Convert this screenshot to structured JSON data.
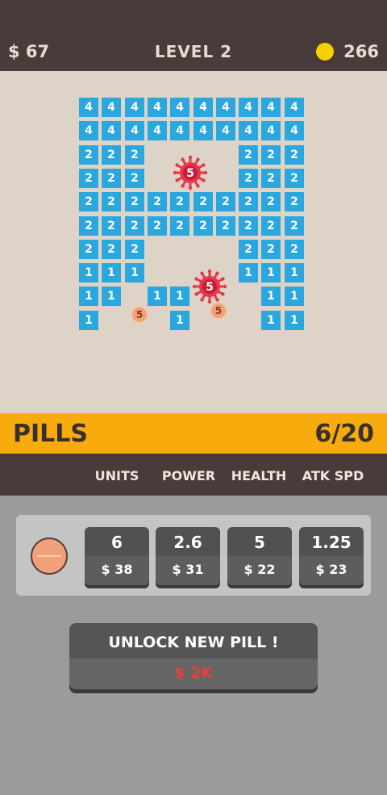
{
  "hud": {
    "money": "$ 67",
    "level": "LEVEL 2",
    "coins": "266",
    "coin_color": "#f5d000"
  },
  "board": {
    "rows": [
      [
        4,
        4,
        4,
        4,
        4,
        4,
        4,
        4,
        4,
        4
      ],
      [
        4,
        4,
        4,
        4,
        4,
        4,
        4,
        4,
        4,
        4
      ],
      [
        2,
        2,
        2,
        null,
        null,
        null,
        null,
        2,
        2,
        2
      ],
      [
        2,
        2,
        2,
        null,
        null,
        null,
        null,
        2,
        2,
        2
      ],
      [
        2,
        2,
        2,
        2,
        2,
        2,
        2,
        2,
        2,
        2
      ],
      [
        2,
        2,
        2,
        2,
        2,
        2,
        2,
        2,
        2,
        2
      ],
      [
        2,
        2,
        2,
        null,
        null,
        null,
        null,
        2,
        2,
        2
      ],
      [
        1,
        1,
        1,
        null,
        null,
        null,
        null,
        1,
        1,
        1
      ],
      [
        1,
        1,
        null,
        1,
        1,
        null,
        null,
        null,
        1,
        1
      ],
      [
        1,
        null,
        null,
        null,
        1,
        null,
        null,
        null,
        1,
        1
      ]
    ],
    "block_color": "#2aa7df",
    "viruses": [
      {
        "value": "5"
      },
      {
        "value": "5"
      }
    ],
    "pills": [
      {
        "value": "5"
      },
      {
        "value": "5"
      }
    ],
    "virus_color": "#e8364a"
  },
  "pills_bar": {
    "title": "PILLS",
    "count": "6/20",
    "color": "#f7ab0d"
  },
  "columns": {
    "units": "UNITS",
    "power": "POWER",
    "health": "HEALTH",
    "atk_spd": "ATK SPD"
  },
  "upgrades": {
    "units": {
      "value": "6",
      "price": "$ 38"
    },
    "power": {
      "value": "2.6",
      "price": "$ 31"
    },
    "health": {
      "value": "5",
      "price": "$ 22"
    },
    "atk_spd": {
      "value": "1.25",
      "price": "$ 23"
    }
  },
  "unlock": {
    "label": "UNLOCK NEW PILL !",
    "price": "$ 2K",
    "price_color": "#e0423f"
  }
}
